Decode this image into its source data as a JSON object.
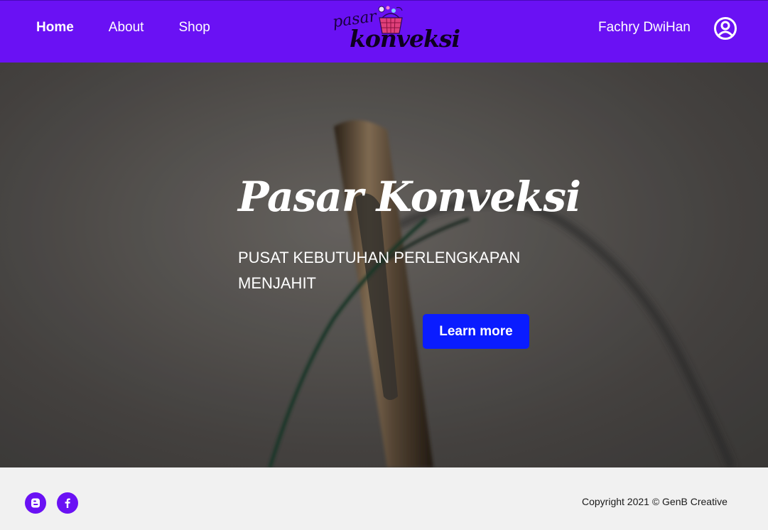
{
  "nav": {
    "links": [
      {
        "label": "Home",
        "active": true
      },
      {
        "label": "About",
        "active": false
      },
      {
        "label": "Shop",
        "active": false
      }
    ],
    "logo": {
      "line1": "pasar",
      "line2": "konveksi"
    },
    "user_name": "Fachry DwiHan",
    "user_icon": "user-circle-icon"
  },
  "hero": {
    "title": "Pasar Konveksi",
    "subtitle": "PUSAT KEBUTUHAN PERLENGKAPAN MENJAHIT",
    "button_label": "Learn more"
  },
  "footer": {
    "social": [
      "blogger-icon",
      "facebook-icon"
    ],
    "copyright": "Copyright 2021  ©  GenB Creative"
  },
  "colors": {
    "nav_bg": "#6a11f4",
    "button_bg": "#0a1cff",
    "footer_bg": "#f1f1f1"
  }
}
